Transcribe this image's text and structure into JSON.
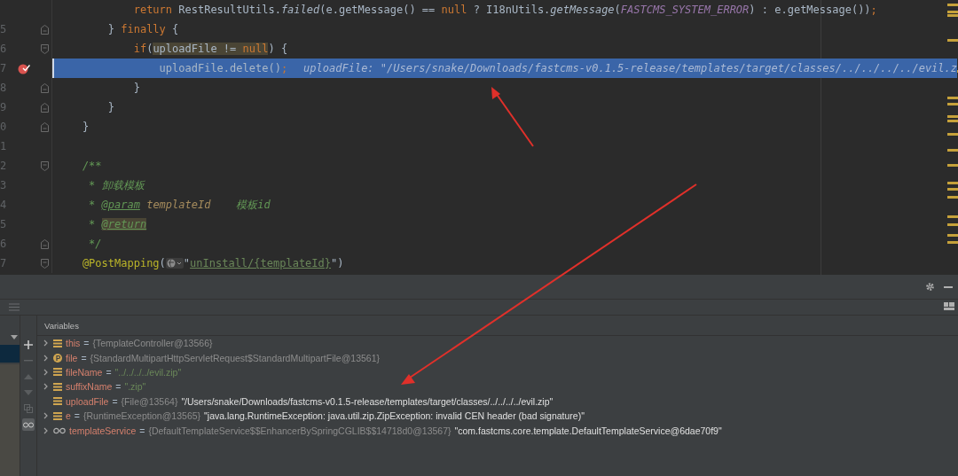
{
  "editor": {
    "lines": [
      {
        "current": false,
        "breakpoint": false,
        "fold_open": false,
        "fold_close": false,
        "tokens": [
          {
            "kind": "keyword",
            "text": "            return"
          },
          {
            "kind": "plain",
            "text": " RestResultUtils."
          },
          {
            "kind": "method",
            "text": "failed"
          },
          {
            "kind": "plain",
            "text": "(e.getMessage() == "
          },
          {
            "kind": "keyword",
            "text": "null"
          },
          {
            "kind": "plain",
            "text": " ? I18nUtils."
          },
          {
            "kind": "method",
            "text": "getMessage"
          },
          {
            "kind": "plain",
            "text": "("
          },
          {
            "kind": "constant",
            "text": "FASTCMS_SYSTEM_ERROR"
          },
          {
            "kind": "plain",
            "text": ") : e.getMessage())"
          },
          {
            "kind": "keyword",
            "text": ";"
          }
        ]
      },
      {
        "number": "5",
        "current": false,
        "breakpoint": false,
        "fold_open": false,
        "fold_close": true,
        "tokens": [
          {
            "kind": "plain",
            "text": "        } "
          },
          {
            "kind": "keyword",
            "text": "finally"
          },
          {
            "kind": "plain",
            "text": " {"
          }
        ]
      },
      {
        "number": "6",
        "current": false,
        "breakpoint": false,
        "fold_open": true,
        "fold_close": false,
        "tokens": [
          {
            "kind": "keyword",
            "text": "            if"
          },
          {
            "kind": "plain",
            "text": "("
          },
          {
            "kind": "match",
            "text": "uploadFile != "
          },
          {
            "kind": "match-keyword",
            "text": "null"
          },
          {
            "kind": "plain",
            "text": ") {"
          }
        ]
      },
      {
        "number": "7",
        "current": true,
        "breakpoint": true,
        "fold_open": false,
        "fold_close": false,
        "tokens": [
          {
            "kind": "plain",
            "text": "                uploadFile.delete()"
          },
          {
            "kind": "keyword",
            "text": ";"
          },
          {
            "kind": "hint",
            "text": "uploadFile: \"/Users/snake/Downloads/fastcms-v0.1.5-release/templates/target/classes/../../../../evil.z"
          }
        ]
      },
      {
        "number": "8",
        "current": false,
        "breakpoint": false,
        "fold_open": false,
        "fold_close": true,
        "tokens": [
          {
            "kind": "plain",
            "text": "            }"
          }
        ]
      },
      {
        "number": "9",
        "current": false,
        "breakpoint": false,
        "fold_open": false,
        "fold_close": true,
        "tokens": [
          {
            "kind": "plain",
            "text": "        }"
          }
        ]
      },
      {
        "number": "0",
        "current": false,
        "breakpoint": false,
        "fold_open": false,
        "fold_close": true,
        "tokens": [
          {
            "kind": "plain",
            "text": "    }"
          }
        ]
      },
      {
        "number": "1",
        "current": false,
        "breakpoint": false,
        "fold_open": false,
        "fold_close": false
      },
      {
        "number": "2",
        "current": false,
        "breakpoint": false,
        "fold_open": true,
        "fold_close": false,
        "tokens": [
          {
            "kind": "comment",
            "text": "    /**"
          }
        ]
      },
      {
        "number": "3",
        "current": false,
        "breakpoint": false,
        "fold_open": false,
        "fold_close": false,
        "tokens": [
          {
            "kind": "comment",
            "text": "     * 卸载模板"
          }
        ]
      },
      {
        "number": "4",
        "current": false,
        "breakpoint": false,
        "fold_open": false,
        "fold_close": false,
        "tokens": [
          {
            "kind": "comment",
            "text": "     * "
          },
          {
            "kind": "doctag",
            "text": "@param"
          },
          {
            "kind": "param",
            "text": " templateId"
          },
          {
            "kind": "comment",
            "text": "    模板id"
          }
        ]
      },
      {
        "number": "5",
        "current": false,
        "breakpoint": false,
        "fold_open": false,
        "fold_close": false,
        "tokens": [
          {
            "kind": "comment",
            "text": "     * "
          },
          {
            "kind": "doctag-match",
            "text": "@return"
          }
        ]
      },
      {
        "number": "6",
        "current": false,
        "breakpoint": false,
        "fold_open": false,
        "fold_close": true,
        "tokens": [
          {
            "kind": "comment",
            "text": "     */"
          }
        ]
      },
      {
        "number": "7",
        "current": false,
        "breakpoint": false,
        "fold_open": true,
        "fold_close": false,
        "tokens": [
          {
            "kind": "annotation",
            "text": "    @PostMapping"
          },
          {
            "kind": "plain",
            "text": "("
          },
          {
            "kind": "globe"
          },
          {
            "kind": "plain",
            "text": "\""
          },
          {
            "kind": "link",
            "text": "unInstall/{templateId}"
          },
          {
            "kind": "plain",
            "text": "\")"
          }
        ]
      }
    ]
  },
  "debugger": {
    "variables_title": "Variables",
    "variables": [
      {
        "kind": "field",
        "expandable": true,
        "name": "this",
        "separator": "=",
        "type": "{TemplateController@13566}"
      },
      {
        "kind": "param",
        "expandable": true,
        "name": "file",
        "separator": "=",
        "type": "{StandardMultipartHttpServletRequest$StandardMultipartFile@13561}"
      },
      {
        "kind": "field",
        "expandable": true,
        "name": "fileName",
        "separator": "=",
        "literal": "\"../../../../evil.zip\""
      },
      {
        "kind": "field",
        "expandable": true,
        "name": "suffixName",
        "separator": "=",
        "literal": "\".zip\""
      },
      {
        "kind": "field",
        "expandable": false,
        "name": "uploadFile",
        "separator": "=",
        "type": "{File@13564}",
        "value": "\"/Users/snake/Downloads/fastcms-v0.1.5-release/templates/target/classes/../../../../evil.zip\""
      },
      {
        "kind": "field",
        "expandable": true,
        "name": "e",
        "separator": "=",
        "type": "{RuntimeException@13565}",
        "value": "\"java.lang.RuntimeException: java.util.zip.ZipException: invalid CEN header (bad signature)\""
      },
      {
        "kind": "watch",
        "expandable": true,
        "name": "templateService",
        "separator": "=",
        "type": "{DefaultTemplateService$$EnhancerBySpringCGLIB$$14718d0@13567}",
        "value": "\"com.fastcms.core.template.DefaultTemplateService@6dae70f9\""
      }
    ]
  }
}
